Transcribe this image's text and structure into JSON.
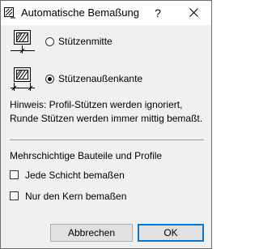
{
  "window": {
    "title": "Automatische Bemaßung",
    "help_label": "?",
    "close_label": "✕"
  },
  "options": [
    {
      "label": "Stützenmitte",
      "selected": false,
      "icon": "column-center-dimension-icon"
    },
    {
      "label": "Stützenaußenkante",
      "selected": true,
      "icon": "column-outer-edge-dimension-icon"
    }
  ],
  "hint": {
    "line1": "Hinweis: Profil-Stützen werden ignoriert,",
    "line2": "Runde Stützen werden immer mittig bemaßt."
  },
  "section": {
    "title": "Mehrschichtige Bauteile und Profile",
    "checkboxes": [
      {
        "label": "Jede Schicht bemaßen",
        "checked": false
      },
      {
        "label": "Nur den Kern bemaßen",
        "checked": false
      }
    ]
  },
  "buttons": {
    "cancel": "Abbrechen",
    "ok": "OK"
  },
  "colors": {
    "window_bg": "#f0f0f0",
    "title_bg": "#ffffff",
    "default_button_border": "#0078d7"
  }
}
